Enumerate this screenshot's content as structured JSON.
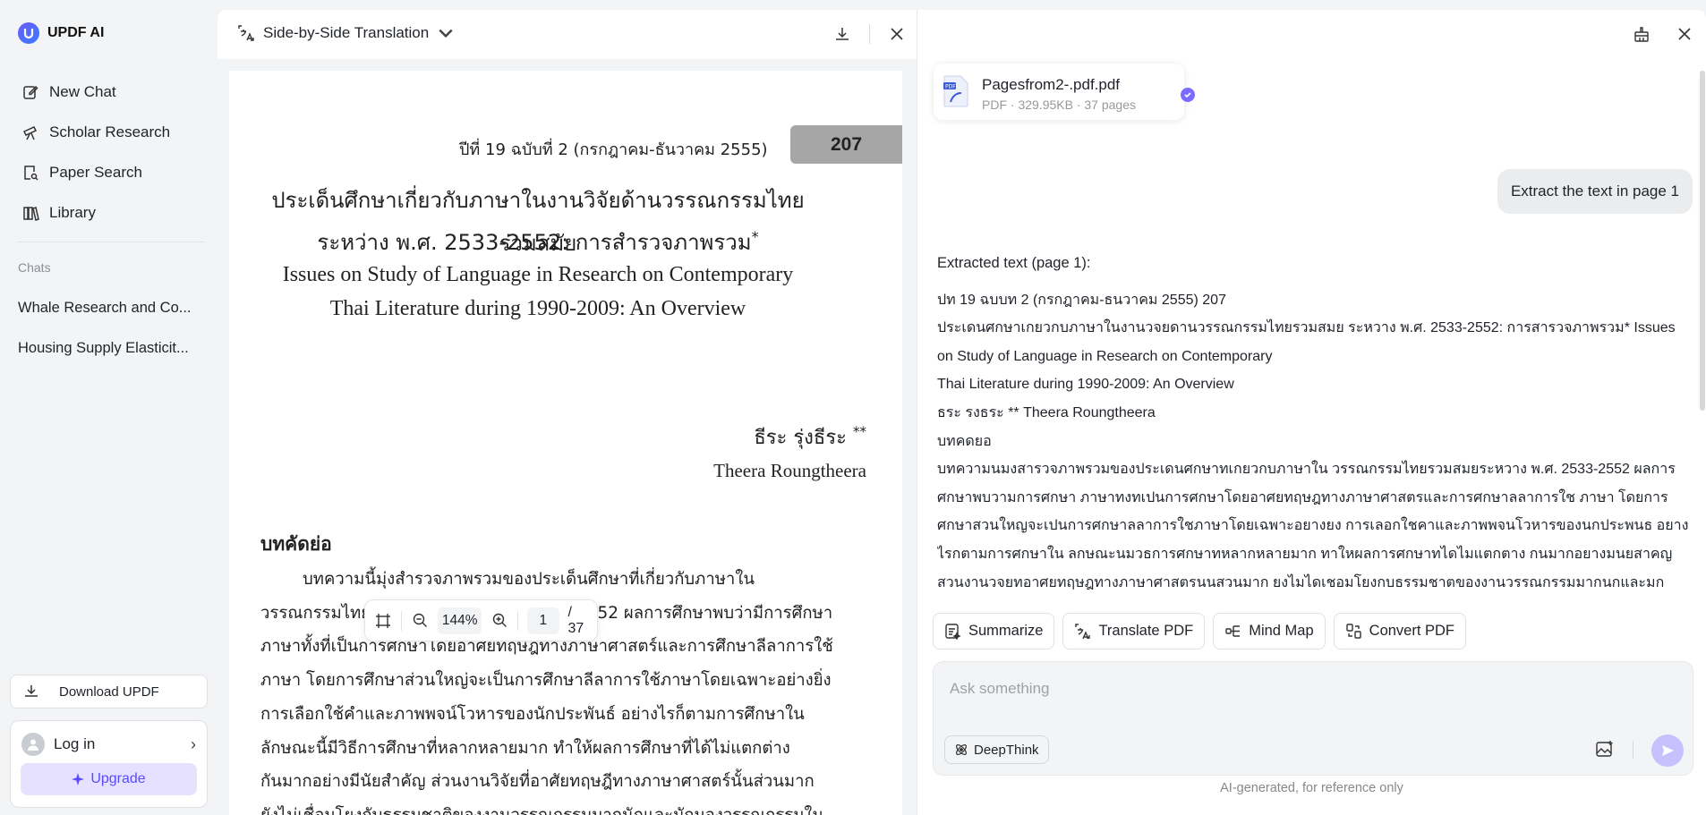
{
  "brand": {
    "name": "UPDF AI"
  },
  "sidebar": {
    "nav": [
      {
        "label": "New Chat",
        "icon": "edit-icon"
      },
      {
        "label": "Scholar Research",
        "icon": "telescope-icon"
      },
      {
        "label": "Paper Search",
        "icon": "doc-search-icon"
      },
      {
        "label": "Library",
        "icon": "library-icon"
      }
    ],
    "chats_label": "Chats",
    "chats": [
      "Whale Research and Co...",
      "Housing Supply Elasticit..."
    ],
    "download_label": "Download UPDF",
    "login_label": "Log in",
    "upgrade_label": "Upgrade"
  },
  "translation": {
    "title": "Side-by-Side Translation",
    "page": {
      "header": "ปีที่ 19 ฉบับที่ 2 (กรกฎาคม-ธันวาคม 2555)",
      "page_number": "207",
      "thai_title_1": "ประเด็นศึกษาเกี่ยวกับภาษาในงานวิจัยด้านวรรณกรรมไทยร่วมสมัย",
      "thai_title_2": "ระหว่าง พ.ศ. 2533-2552: การสำรวจภาพรวม",
      "thai_title_mark": "*",
      "eng_title_1": "Issues on Study of Language in Research on Contemporary",
      "eng_title_2": "Thai Literature during 1990-2009: An Overview",
      "author_th": "ธีระ รุ่งธีระ",
      "author_mark": "**",
      "author_en": "Theera Roungtheera",
      "abstract_heading": "บทคัดย่อ",
      "abstract_lines": [
        "        บทความนี้มุ่งสำรวจภาพรวมของประเด็นศึกษาที่เกี่ยวกับภาษาใน",
        "วรรณกรรมไทยร่วมสมัยระหว่าง พ.ศ. 2533-2552 ผลการศึกษาพบว่ามีการศึกษา",
        "ภาษาทั้งที่เป็นการศึกษาโดยอาศัยทฤษฎีทางภาษาศาสตร์และการศึกษาลีลาการใช้",
        "ภาษา โดยการศึกษาส่วนใหญ่จะเป็นการศึกษาลีลาการใช้ภาษาโดยเฉพาะอย่างยิ่ง",
        "การเลือกใช้คำและภาพพจน์โวหารของนักประพันธ์ อย่างไรก็ตามการศึกษาใน",
        "ลักษณะนี้มีวิธีการศึกษาที่หลากหลายมาก ทำให้ผลการศึกษาที่ได้ไม่แตกต่าง",
        "กันมากอย่างมีนัยสำคัญ ส่วนงานวิจัยที่อาศัยทฤษฎีทางภาษาศาสตร์นั้นส่วนมาก",
        "ยังไม่เชื่อมโยงกับธรรมชาติของงานวรรณกรรมมากนักและมักมองวรรณกรรมใน"
      ]
    },
    "toolbar": {
      "zoom": "144%",
      "current_page": "1",
      "total_pages": "/ 37"
    }
  },
  "chat": {
    "file": {
      "name": "Pagesfrom2-.pdf.pdf",
      "meta": "PDF · 329.95KB · 37 pages"
    },
    "user_message": "Extract the text in page 1",
    "ai_heading": "Extracted text (page 1):",
    "ai_lines": [
      "ปท 19 ฉบบท 2 (กรกฎาคม-ธนวาคม 2555) 207",
      "ประเดนศกษาเกยวกบภาษาในงานวจยดานวรรณกรรมไทยรวมสมย ระหวาง พ.ศ. 2533-2552: การสารวจภาพรวม* Issues on Study of Language in Research on Contemporary",
      "Thai Literature during 1990-2009: An Overview",
      "ธระ รงธระ ** Theera Roungtheera",
      "บทคดยอ",
      "บทความนมงสารวจภาพรวมของประเดนศกษาทเกยวกบภาษาใน วรรณกรรมไทยรวมสมยระหวาง พ.ศ. 2533-2552 ผลการศกษาพบวามการศกษา ภาษาทงทเปนการศกษาโดยอาศยทฤษฎทางภาษาศาสตรและการศกษาลลาการใช ภาษา โดยการศกษาสวนใหญจะเปนการศกษาลลาการใชภาษาโดยเฉพาะอยางยง การเลอกใชคาและภาพพจนโวหารของนกประพนธ อยางไรกตามการศกษาใน ลกษณะนมวธการศกษาทหลากหลายมาก ทาใหผลการศกษาทไดไมแตกตาง กนมากอยางมนยสาคญ สวนงานวจยทอาศยทฤษฎทางภาษาศาสตรนนสวนมาก ยงไมไดเชอมโยงกบธรรมชาตของงานวรรณกรรมมากนกและมกมองวรรณกรรมใน"
    ],
    "actions": [
      "Summarize",
      "Translate PDF",
      "Mind Map",
      "Convert PDF"
    ],
    "input_placeholder": "Ask something",
    "deepthink_label": "DeepThink",
    "disclaimer": "AI-generated, for reference only"
  },
  "colors": {
    "accent": "#5a4bff",
    "upgrade_bg": "#e5e1ff",
    "send_disabled": "#c6c0ff"
  }
}
